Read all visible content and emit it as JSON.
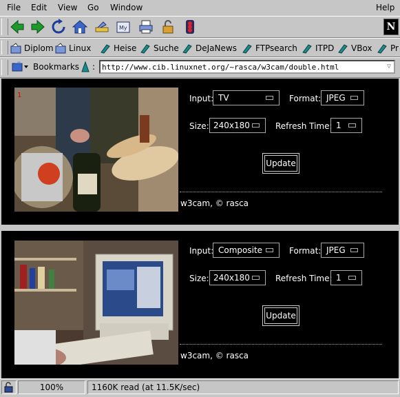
{
  "menu": {
    "items": [
      "File",
      "Edit",
      "View",
      "Go",
      "Window"
    ],
    "help": "Help"
  },
  "toolbar": {
    "buttons": [
      "back-icon",
      "forward-icon",
      "reload-icon",
      "home-icon",
      "search-icon",
      "mail-icon",
      "print-icon",
      "security-lock-icon",
      "stop-icon"
    ],
    "netscape_logo": "N"
  },
  "personal_toolbar": {
    "items": [
      "Diplom",
      "Linux",
      "Heise",
      "Suche",
      "DeJaNews",
      "FTPsearch",
      "ITPD",
      "VBox",
      "Pr"
    ]
  },
  "location": {
    "bookmarks_label": "Bookmarks",
    "separator": ":",
    "url": "http://www.cib.linuxnet.org/~rasca/w3cam/double.html"
  },
  "cameras": [
    {
      "input_label": "Input:",
      "input_value": "TV",
      "format_label": "Format:",
      "format_value": "JPEG",
      "size_label": "Size:",
      "size_value": "240x180",
      "refresh_label": "Refresh Time:",
      "refresh_value": "1",
      "update_label": "Update",
      "footer": "w3cam, © rasca"
    },
    {
      "input_label": "Input:",
      "input_value": "Composite",
      "format_label": "Format:",
      "format_value": "JPEG",
      "size_label": "Size:",
      "size_value": "240x180",
      "refresh_label": "Refresh Time:",
      "refresh_value": "1",
      "update_label": "Update",
      "footer": "w3cam, © rasca"
    }
  ],
  "status": {
    "zoom": "100%",
    "message": "1160K read (at 11.5K/sec)"
  }
}
